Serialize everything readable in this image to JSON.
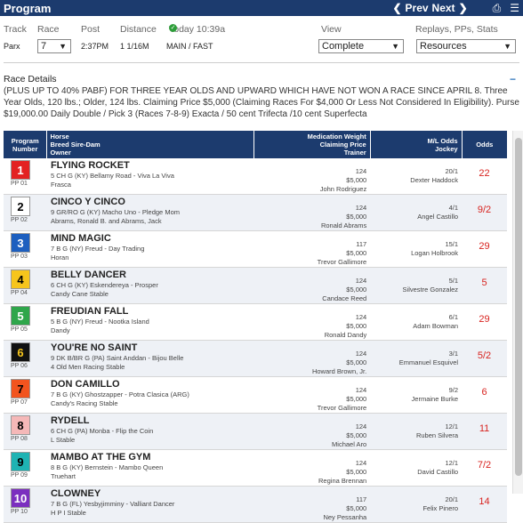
{
  "header": {
    "title": "Program",
    "prev": "Prev",
    "next": "Next",
    "prev_icon": "chevron-left",
    "next_icon": "chevron-right",
    "print_icon": "print",
    "menu_icon": "hamburger"
  },
  "filters": {
    "track_label": "Track",
    "race_label": "Race",
    "post_label": "Post",
    "distance_label": "Distance",
    "today_label": "Today 10:39a",
    "view_label": "View",
    "replays_label": "Replays, PPs, Stats",
    "track_value": "Parx",
    "race_value": "7",
    "post_value": "2:37PM",
    "distance_value": "1 1/16M",
    "surface_value": "MAIN / FAST",
    "view_value": "Complete",
    "replays_value": "Resources"
  },
  "race_details": {
    "title": "Race Details",
    "collapse": "−",
    "text": "(PLUS UP TO 40% PABF) FOR THREE YEAR OLDS AND UPWARD WHICH HAVE NOT WON A RACE SINCE APRIL 8. Three Year Olds, 120 lbs.; Older, 124 lbs. Claiming Price $5,000 (Claiming Races For $4,000 Or Less Not Considered In Eligibility). Purse $19,000.00 Daily Double / Pick 3 (Races 7-8-9) Exacta / 50 cent Trifecta /10 cent Superfecta"
  },
  "table": {
    "col_program1": "Program",
    "col_program2": "Number",
    "col_horse1": "Horse",
    "col_horse2": "Breed Sire-Dam",
    "col_horse3": "Owner",
    "col_med1": "Medication Weight",
    "col_med2": "Claiming Price",
    "col_med3": "Trainer",
    "col_ml1": "M/L Odds",
    "col_ml2": "Jockey",
    "col_odds": "Odds"
  },
  "rows": [
    {
      "num": "1",
      "pp": "PP 01",
      "name": "FLYING ROCKET",
      "breed": "5 CH G (KY) Bellamy Road - Viva La Viva",
      "owner": "Frasca",
      "weight": "124",
      "claim": "$5,000",
      "trainer": "John Rodriguez",
      "ml": "20/1",
      "jockey": "Dexter Haddock",
      "odds": "22",
      "bg": "#e32222",
      "fg": "#ffffff"
    },
    {
      "num": "2",
      "pp": "PP 02",
      "name": "CINCO Y CINCO",
      "breed": "9 GR/RO G (KY) Macho Uno - Pledge Mom",
      "owner": "Abrams, Ronald B. and Abrams, Jack",
      "weight": "124",
      "claim": "$5,000",
      "trainer": "Ronald Abrams",
      "ml": "4/1",
      "jockey": "Angel Castillo",
      "odds": "9/2",
      "bg": "#ffffff",
      "fg": "#000000"
    },
    {
      "num": "3",
      "pp": "PP 03",
      "name": "MIND MAGIC",
      "breed": "7 B G (NY) Freud - Day Trading",
      "owner": "Horan",
      "weight": "117",
      "claim": "$5,000",
      "trainer": "Trevor Gallimore",
      "ml": "15/1",
      "jockey": "Logan Holbrook",
      "odds": "29",
      "bg": "#1d5fbf",
      "fg": "#ffffff"
    },
    {
      "num": "4",
      "pp": "PP 04",
      "name": "BELLY DANCER",
      "breed": "6 CH G (KY) Eskendereya - Prosper",
      "owner": "Candy Cane Stable",
      "weight": "124",
      "claim": "$5,000",
      "trainer": "Candace Reed",
      "ml": "5/1",
      "jockey": "Silvestre Gonzalez",
      "odds": "5",
      "bg": "#f6c51c",
      "fg": "#000000"
    },
    {
      "num": "5",
      "pp": "PP 05",
      "name": "FREUDIAN FALL",
      "breed": "5 B G (NY) Freud - Nootka Island",
      "owner": "Dandy",
      "weight": "124",
      "claim": "$5,000",
      "trainer": "Ronald Dandy",
      "ml": "6/1",
      "jockey": "Adam Bowman",
      "odds": "29",
      "bg": "#2ea64a",
      "fg": "#ffffff"
    },
    {
      "num": "6",
      "pp": "PP 06",
      "name": "YOU'RE NO SAINT",
      "breed": "9 DK B/BR G (PA) Saint Anddan - Bijou Belle",
      "owner": "4 Old Men Racing Stable",
      "weight": "124",
      "claim": "$5,000",
      "trainer": "Howard Brown, Jr.",
      "ml": "3/1",
      "jockey": "Emmanuel Esquivel",
      "odds": "5/2",
      "bg": "#111111",
      "fg": "#f6c51c"
    },
    {
      "num": "7",
      "pp": "PP 07",
      "name": "DON CAMILLO",
      "breed": "7 B G (KY) Ghostzapper - Potra Clasica (ARG)",
      "owner": "Candy's Racing Stable",
      "weight": "124",
      "claim": "$5,000",
      "trainer": "Trevor Gallimore",
      "ml": "9/2",
      "jockey": "Jermaine Burke",
      "odds": "6",
      "bg": "#f2541e",
      "fg": "#000000"
    },
    {
      "num": "8",
      "pp": "PP 08",
      "name": "RYDELL",
      "breed": "6 CH G (PA) Monba - Flip the Coin",
      "owner": "L Stable",
      "weight": "124",
      "claim": "$5,000",
      "trainer": "Michael Aro",
      "ml": "12/1",
      "jockey": "Ruben Silvera",
      "odds": "11",
      "bg": "#f5b8b8",
      "fg": "#000000"
    },
    {
      "num": "9",
      "pp": "PP 09",
      "name": "MAMBO AT THE GYM",
      "breed": "8 B G (KY) Bernstein - Mambo Queen",
      "owner": "Truehart",
      "weight": "124",
      "claim": "$5,000",
      "trainer": "Regina Brennan",
      "ml": "12/1",
      "jockey": "David Castillo",
      "odds": "7/2",
      "bg": "#1eb3b3",
      "fg": "#000000"
    },
    {
      "num": "10",
      "pp": "PP 10",
      "name": "CLOWNEY",
      "breed": "7 B G (FL) Yesbyjimminy - Valliant Dancer",
      "owner": "H P I Stable",
      "weight": "117",
      "claim": "$5,000",
      "trainer": "Ney Pessanha",
      "ml": "20/1",
      "jockey": "Felix Pinero",
      "odds": "14",
      "bg": "#7b2fbf",
      "fg": "#ffffff"
    }
  ]
}
